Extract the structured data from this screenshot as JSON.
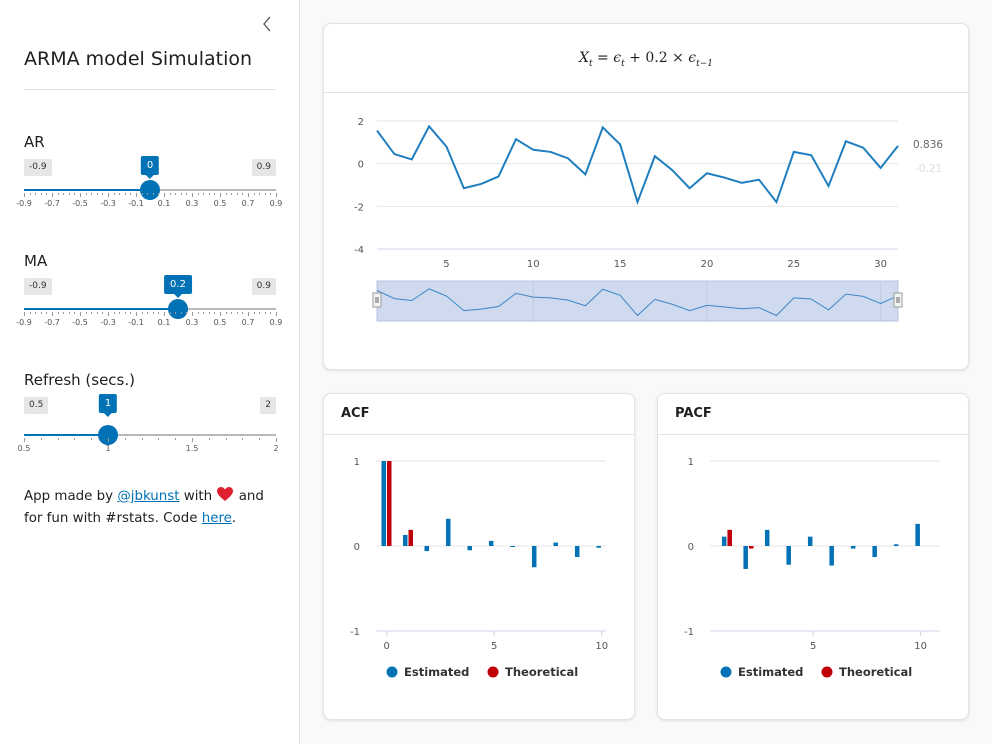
{
  "sidebar": {
    "title": "ARMA model Simulation",
    "sliders": [
      {
        "label": "AR",
        "min_label": "-0.9",
        "max_label": "0.9",
        "value_label": "0",
        "value": 0,
        "min": -0.9,
        "max": 0.9,
        "ticks": [
          "-0.9",
          "-0.7",
          "-0.5",
          "-0.3",
          "-0.1",
          "0.1",
          "0.3",
          "0.5",
          "0.7",
          "0.9"
        ]
      },
      {
        "label": "MA",
        "min_label": "-0.9",
        "max_label": "0.9",
        "value_label": "0.2",
        "value": 0.2,
        "min": -0.9,
        "max": 0.9,
        "ticks": [
          "-0.9",
          "-0.7",
          "-0.5",
          "-0.3",
          "-0.1",
          "0.1",
          "0.3",
          "0.5",
          "0.7",
          "0.9"
        ]
      },
      {
        "label": "Refresh (secs.)",
        "min_label": "0.5",
        "max_label": "2",
        "value_label": "1",
        "value": 1,
        "min": 0.5,
        "max": 2,
        "ticks": [
          "0.5",
          "1",
          "1.5",
          "2"
        ]
      }
    ],
    "credits": {
      "prefix": "App made by ",
      "author_link": "@jbkunst",
      "middle": " with ",
      "suffix": " and for fun with #rstats. Code ",
      "code_link": "here",
      "end": "."
    }
  },
  "timeseries": {
    "formula": {
      "x": "X",
      "x_sub": "t",
      "eq": " = ",
      "e1": "ϵ",
      "e1_sub": "t",
      "plus": " + 0.2 × ",
      "e2": "ϵ",
      "e2_sub": "t−1"
    },
    "last_value_label": "0.836",
    "faded_value_label": "-0.21"
  },
  "acf": {
    "title": "ACF",
    "legend": {
      "estimated": "Estimated",
      "theoretical": "Theoretical"
    }
  },
  "pacf": {
    "title": "PACF",
    "legend": {
      "estimated": "Estimated",
      "theoretical": "Theoretical"
    }
  },
  "colors": {
    "accent": "#0072b5",
    "theoretical": "#c0000a",
    "line": "#1f7ec0",
    "navigator": "#cfdaef"
  },
  "chart_data": [
    {
      "type": "line",
      "x": [
        1,
        2,
        3,
        4,
        5,
        6,
        7,
        8,
        9,
        10,
        11,
        12,
        13,
        14,
        15,
        16,
        17,
        18,
        19,
        20,
        21,
        22,
        23,
        24,
        25,
        26,
        27,
        28,
        29,
        30,
        31
      ],
      "values": [
        1.55,
        0.45,
        0.2,
        1.75,
        0.8,
        -1.15,
        -0.95,
        -0.6,
        1.15,
        0.65,
        0.55,
        0.25,
        -0.5,
        1.7,
        0.9,
        -1.8,
        0.35,
        -0.3,
        -1.15,
        -0.45,
        -0.65,
        -0.9,
        -0.75,
        -1.8,
        0.55,
        0.4,
        -1.05,
        1.05,
        0.75,
        -0.2,
        0.836
      ],
      "x_ticks": [
        "5",
        "10",
        "15",
        "20",
        "25",
        "30"
      ],
      "x_tick_values": [
        5,
        10,
        15,
        20,
        25,
        30
      ],
      "y_ticks": [
        "2",
        "0",
        "-2",
        "-4"
      ],
      "y_tick_values": [
        2,
        0,
        -2,
        -4
      ],
      "ylim": [
        -4,
        2
      ],
      "xlim": [
        1,
        31
      ],
      "grid": true,
      "navigator": true
    },
    {
      "type": "bar",
      "title": "ACF",
      "x_ticks": [
        "0",
        "5",
        "10"
      ],
      "x_tick_values": [
        0,
        5,
        10
      ],
      "y_ticks": [
        "1",
        "0",
        "-1"
      ],
      "y_tick_values": [
        1,
        0,
        -1
      ],
      "ylim": [
        -1,
        1
      ],
      "xlim": [
        -0.5,
        10.2
      ],
      "series": [
        {
          "name": "Estimated",
          "color": "#0072b5",
          "lags": [
            0,
            1,
            2,
            3,
            4,
            5,
            6,
            7,
            8,
            9,
            10
          ],
          "values": [
            1,
            0.13,
            -0.06,
            0.32,
            -0.05,
            0.06,
            -0.01,
            -0.25,
            0.04,
            -0.13,
            -0.02
          ]
        },
        {
          "name": "Theoretical",
          "color": "#c0000a",
          "lags": [
            0,
            1
          ],
          "values": [
            1,
            0.19
          ]
        }
      ],
      "legend": "bottom"
    },
    {
      "type": "bar",
      "title": "PACF",
      "x_ticks": [
        "5",
        "10"
      ],
      "x_tick_values": [
        5,
        10
      ],
      "y_ticks": [
        "1",
        "0",
        "-1"
      ],
      "y_tick_values": [
        1,
        0,
        -1
      ],
      "ylim": [
        -1,
        1
      ],
      "xlim": [
        0.2,
        10.9
      ],
      "series": [
        {
          "name": "Estimated",
          "color": "#0072b5",
          "lags": [
            1,
            2,
            3,
            4,
            5,
            6,
            7,
            8,
            9,
            10
          ],
          "values": [
            0.11,
            -0.27,
            0.19,
            -0.22,
            0.11,
            -0.23,
            -0.03,
            -0.13,
            0.02,
            0.26
          ]
        },
        {
          "name": "Theoretical",
          "color": "#c0000a",
          "lags": [
            1,
            2
          ],
          "values": [
            0.19,
            -0.03
          ]
        }
      ],
      "legend": "bottom"
    }
  ]
}
